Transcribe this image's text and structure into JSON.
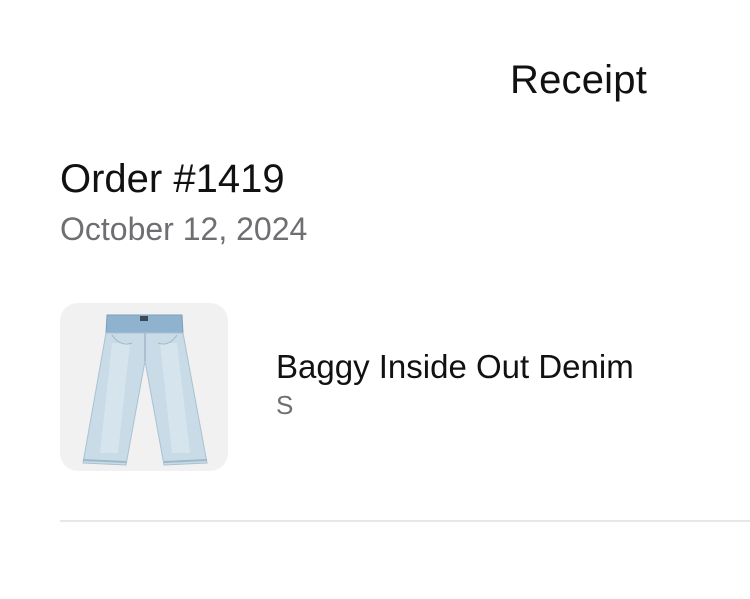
{
  "header": {
    "title": "Receipt"
  },
  "order": {
    "number": "Order #1419",
    "date": "October 12, 2024"
  },
  "items": [
    {
      "name": "Baggy Inside Out Denim",
      "variant": "S",
      "thumbnail_icon": "jeans-product-image"
    }
  ]
}
